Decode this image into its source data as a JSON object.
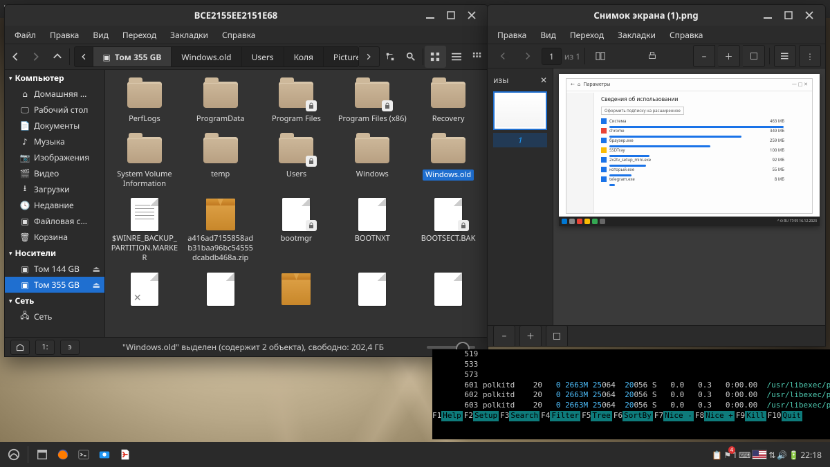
{
  "fm": {
    "title": "BCE2155EE2151E68",
    "menus": [
      "Файл",
      "Правка",
      "Вид",
      "Переход",
      "Закладки",
      "Справка"
    ],
    "path": [
      {
        "label": "Том 355 GB",
        "active": true,
        "icon": true
      },
      {
        "label": "Windows.old"
      },
      {
        "label": "Users"
      },
      {
        "label": "Коля"
      },
      {
        "label": "Pictures"
      }
    ],
    "sidebar": {
      "computer": {
        "header": "Компьютер",
        "items": [
          {
            "label": "Домашняя …",
            "icon": "home"
          },
          {
            "label": "Рабочий стол",
            "icon": "desktop"
          },
          {
            "label": "Документы",
            "icon": "doc"
          },
          {
            "label": "Музыка",
            "icon": "music"
          },
          {
            "label": "Изображения",
            "icon": "image"
          },
          {
            "label": "Видео",
            "icon": "video"
          },
          {
            "label": "Загрузки",
            "icon": "download"
          },
          {
            "label": "Недавние",
            "icon": "recent"
          },
          {
            "label": "Файловая с…",
            "icon": "disk"
          },
          {
            "label": "Корзина",
            "icon": "trash"
          }
        ]
      },
      "media": {
        "header": "Носители",
        "items": [
          {
            "label": "Том 144 GB",
            "eject": true
          },
          {
            "label": "Том 355 GB",
            "eject": true,
            "selected": true
          }
        ]
      },
      "network": {
        "header": "Сеть",
        "items": [
          {
            "label": "Сеть",
            "icon": "net"
          }
        ]
      }
    },
    "files": [
      {
        "label": "PerfLogs",
        "type": "folder"
      },
      {
        "label": "ProgramData",
        "type": "folder"
      },
      {
        "label": "Program Files",
        "type": "folder",
        "locked": true
      },
      {
        "label": "Program Files (x86)",
        "type": "folder",
        "locked": true
      },
      {
        "label": "Recovery",
        "type": "folder"
      },
      {
        "label": "System Volume Information",
        "type": "folder"
      },
      {
        "label": "temp",
        "type": "folder"
      },
      {
        "label": "Users",
        "type": "folder",
        "locked": true
      },
      {
        "label": "Windows",
        "type": "folder"
      },
      {
        "label": "Windows.old",
        "type": "folder",
        "selected": true
      },
      {
        "label": "$WINRE_BACKUP_PARTITION.MARKER",
        "type": "txt"
      },
      {
        "label": "a416ad7155858adb31baa96bc54555dcabdb468a.zip",
        "type": "archive"
      },
      {
        "label": "bootmgr",
        "type": "doc",
        "locked": true
      },
      {
        "label": "BOOTNXT",
        "type": "doc"
      },
      {
        "label": "BOOTSECT.BAK",
        "type": "doc",
        "locked": true
      },
      {
        "label": "",
        "type": "broken"
      },
      {
        "label": "",
        "type": "doc"
      },
      {
        "label": "",
        "type": "archive"
      },
      {
        "label": "",
        "type": "doc"
      },
      {
        "label": "",
        "type": "doc"
      }
    ],
    "status": "\"Windows.old\" выделен (содержит 2 объекта), свободно: 202,4 ГБ"
  },
  "iv": {
    "title": "Снимок экрана (1).png",
    "menus": [
      "Правка",
      "Вид",
      "Переход",
      "Закладки",
      "Справка"
    ],
    "page_field": "1",
    "page_of": "из 1",
    "thumbs_hdr": "изы",
    "thumb_label": "1",
    "ss": {
      "title": "Сведения об использовании",
      "btn": "Оформить подписку на расширенное",
      "rows": [
        {
          "name": "Система",
          "val": "463 МБ",
          "bar": 95,
          "color": "#1a73e8"
        },
        {
          "name": "chrome",
          "val": "349 МБ",
          "bar": 72,
          "color": "#ea4335"
        },
        {
          "name": "браузер.exe",
          "val": "259 МБ",
          "bar": 55,
          "color": "#1a73e8"
        },
        {
          "name": "SSDTray",
          "val": "100 МБ",
          "bar": 22,
          "color": "#fbbc04"
        },
        {
          "name": "2x2tv_setup_mini.exe",
          "val": "92 МБ",
          "bar": 20,
          "color": "#1a73e8"
        },
        {
          "name": "который.exe",
          "val": "55 МБ",
          "bar": 12,
          "color": "#1a73e8"
        },
        {
          "name": "telegram.exe",
          "val": "8 МБ",
          "bar": 3,
          "color": "#1a73e8"
        }
      ]
    }
  },
  "term": {
    "lines": [
      {
        "n": "519"
      },
      {
        "n": "533"
      },
      {
        "n": "573"
      },
      {
        "n": "601",
        "proc": "polkitd",
        "pr": "20",
        "ni": "0",
        "virt": "2663M",
        "res": "25064",
        "shr": "20056",
        "s": "S",
        "cpu": "0.0",
        "mem": "0.3",
        "time": "0:00.00",
        "cmd": "/usr/libexec/po"
      },
      {
        "n": "602",
        "proc": "polkitd",
        "pr": "20",
        "ni": "0",
        "virt": "2663M",
        "res": "25064",
        "shr": "20056",
        "s": "S",
        "cpu": "0.0",
        "mem": "0.3",
        "time": "0:00.00",
        "cmd": "/usr/libexec/po"
      },
      {
        "n": "603",
        "proc": "polkitd",
        "pr": "20",
        "ni": "0",
        "virt": "2663M",
        "res": "25064",
        "shr": "20056",
        "s": "S",
        "cpu": "0.0",
        "mem": "0.3",
        "time": "0:00.00",
        "cmd": "/usr/libexec/po"
      }
    ],
    "fkeys": [
      [
        "F1",
        "Help"
      ],
      [
        "F2",
        "Setup"
      ],
      [
        "F3",
        "Search"
      ],
      [
        "F4",
        "Filter"
      ],
      [
        "F5",
        "Tree"
      ],
      [
        "F6",
        "SortBy"
      ],
      [
        "F7",
        "Nice -"
      ],
      [
        "F8",
        "Nice +"
      ],
      [
        "F9",
        "Kill"
      ],
      [
        "F10",
        "Quit"
      ]
    ]
  },
  "tray": {
    "time": "22:18",
    "kb_count": "1"
  },
  "sb_btns": [
    "1:",
    "э"
  ]
}
